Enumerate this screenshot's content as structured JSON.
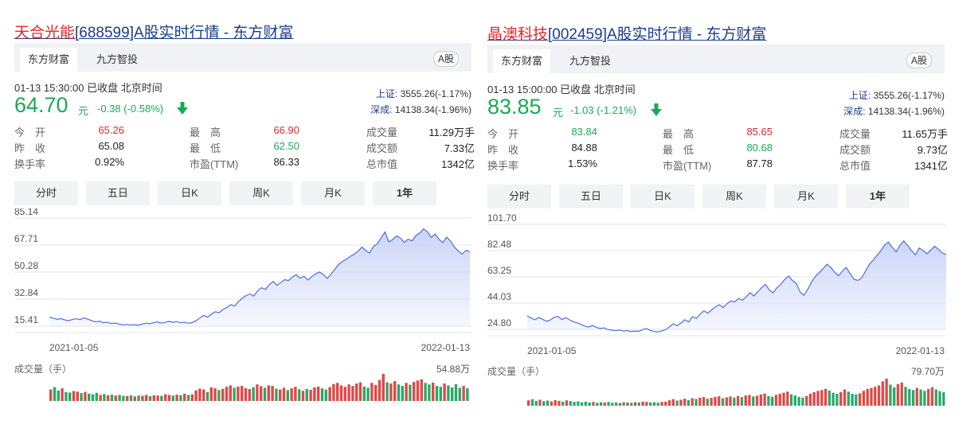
{
  "panels": [
    {
      "title_name": "天合光能",
      "title_rest": "[688599]A股实时行情 - 东方财富",
      "sources": [
        "东方财富",
        "九方智投"
      ],
      "badge": "A股",
      "time_status": "01-13 15:30:00  已收盘  北京时间",
      "price": "64.70",
      "unit": "元",
      "change": "-0.38 (-0.58%)",
      "indices": [
        {
          "label": "上证:",
          "value": "3555.26(-1.17%)"
        },
        {
          "label": "深成:",
          "value": "14138.34(-1.96%)"
        }
      ],
      "stats": [
        [
          {
            "label": "今　开",
            "value": "65.26",
            "tone": "red"
          },
          {
            "label": "最　高",
            "value": "66.90",
            "tone": "red"
          },
          {
            "label": "成交量",
            "value": "11.29万手",
            "tone": "dark"
          }
        ],
        [
          {
            "label": "昨　收",
            "value": "65.08",
            "tone": "dark"
          },
          {
            "label": "最　低",
            "value": "62.50",
            "tone": "green"
          },
          {
            "label": "成交额",
            "value": "7.33亿",
            "tone": "dark"
          }
        ],
        [
          {
            "label": "换手率",
            "value": "0.92%",
            "tone": "dark"
          },
          {
            "label": "市盈(TTM)",
            "value": "86.33",
            "tone": "dark"
          },
          {
            "label": "总市值",
            "value": "1342亿",
            "tone": "dark"
          }
        ]
      ],
      "tabs": [
        "分时",
        "五日",
        "日K",
        "周K",
        "月K",
        "1年"
      ],
      "active_tab": "1年",
      "volume_label": "成交量（手）",
      "volume_max": "54.88万",
      "chart_data": {
        "type": "area",
        "title": "",
        "x_start": "2021-01-05",
        "x_end": "2022-01-13",
        "ylim": [
          15.41,
          85.14
        ],
        "yticks": [
          "85.14",
          "67.71",
          "50.28",
          "32.84",
          "15.41"
        ],
        "grid": true,
        "line_color": "#4a6fe0",
        "fill_color": "#c8d2f6",
        "values": [
          21.2,
          20.6,
          19.8,
          20.3,
          19.4,
          18.9,
          19.8,
          20.2,
          19.6,
          20.8,
          19.9,
          18.9,
          18.2,
          18.6,
          17.6,
          17.9,
          17.1,
          17.4,
          16.8,
          16.2,
          16.6,
          16.1,
          16.4,
          16.0,
          16.7,
          17.3,
          17.0,
          17.6,
          18.1,
          17.4,
          17.8,
          18.5,
          17.9,
          18.4,
          17.6,
          17.9,
          17.3,
          17.7,
          18.9,
          20.7,
          22.4,
          21.2,
          23.2,
          24.7,
          24.1,
          26.2,
          27.4,
          29.2,
          28.4,
          31.2,
          33.4,
          35.1,
          36.2,
          34.8,
          38.3,
          40.2,
          39.1,
          42.1,
          44.3,
          41.7,
          43.5,
          45.4,
          44.8,
          47.2,
          48.6,
          46.3,
          47.6,
          45.2,
          47.3,
          49.1,
          50.4,
          48.7,
          46.2,
          48.8,
          52.1,
          55.3,
          57.2,
          58.6,
          60.4,
          61.8,
          63.7,
          66.4,
          64.1,
          62.6,
          66.9,
          68.4,
          72.4,
          76.1,
          69.7,
          71.3,
          73.6,
          72.1,
          69.4,
          71.5,
          70.3,
          73.8,
          75.4,
          78.1,
          76.2,
          72.6,
          74.8,
          71.4,
          69.3,
          72.8,
          70.2,
          66.4,
          63.8,
          61.8,
          64.3,
          63.3
        ]
      },
      "volume": [
        0.38,
        0.46,
        0.35,
        0.42,
        0.3,
        0.28,
        0.33,
        0.31,
        0.26,
        0.3,
        0.24,
        0.22,
        0.27,
        0.2,
        0.23,
        0.19,
        0.21,
        0.18,
        0.2,
        0.17,
        0.16,
        0.19,
        0.15,
        0.18,
        0.17,
        0.2,
        0.16,
        0.19,
        0.18,
        0.17,
        0.22,
        0.2,
        0.18,
        0.21,
        0.19,
        0.24,
        0.2,
        0.22,
        0.35,
        0.41,
        0.38,
        0.3,
        0.45,
        0.42,
        0.36,
        0.4,
        0.47,
        0.52,
        0.44,
        0.48,
        0.5,
        0.43,
        0.4,
        0.46,
        0.55,
        0.49,
        0.44,
        0.52,
        0.5,
        0.41,
        0.38,
        0.44,
        0.36,
        0.42,
        0.47,
        0.39,
        0.34,
        0.4,
        0.37,
        0.45,
        0.48,
        0.42,
        0.38,
        0.46,
        0.56,
        0.6,
        0.52,
        0.47,
        0.55,
        0.5,
        0.58,
        0.62,
        0.48,
        0.44,
        0.6,
        0.53,
        0.7,
        0.9,
        0.62,
        0.58,
        0.66,
        0.55,
        0.5,
        0.6,
        0.54,
        0.63,
        0.68,
        0.72,
        0.6,
        0.55,
        0.61,
        0.5,
        0.47,
        0.58,
        0.52,
        0.45,
        0.56,
        0.44,
        0.5,
        0.42
      ],
      "volume_colors": {
        "up": "#e04848",
        "down": "#29a86a"
      }
    },
    {
      "title_name": "晶澳科技",
      "title_rest": "[002459]A股实时行情 - 东方财富",
      "sources": [
        "东方财富",
        "九方智投"
      ],
      "badge": "A股",
      "time_status": "01-13 15:00:00  已收盘  北京时间",
      "price": "83.85",
      "unit": "元",
      "change": "-1.03 (-1.21%)",
      "indices": [
        {
          "label": "上证:",
          "value": "3555.26(-1.17%)"
        },
        {
          "label": "深成:",
          "value": "14138.34(-1.96%)"
        }
      ],
      "stats": [
        [
          {
            "label": "今　开",
            "value": "83.84",
            "tone": "green"
          },
          {
            "label": "最　高",
            "value": "85.65",
            "tone": "red"
          },
          {
            "label": "成交量",
            "value": "11.65万手",
            "tone": "dark"
          }
        ],
        [
          {
            "label": "昨　收",
            "value": "84.88",
            "tone": "dark"
          },
          {
            "label": "最　低",
            "value": "80.68",
            "tone": "green"
          },
          {
            "label": "成交额",
            "value": "9.73亿",
            "tone": "dark"
          }
        ],
        [
          {
            "label": "换手率",
            "value": "1.53%",
            "tone": "dark"
          },
          {
            "label": "市盈(TTM)",
            "value": "87.78",
            "tone": "dark"
          },
          {
            "label": "总市值",
            "value": "1341亿",
            "tone": "dark"
          }
        ]
      ],
      "tabs": [
        "分时",
        "五日",
        "日K",
        "周K",
        "月K",
        "1年"
      ],
      "active_tab": "1年",
      "volume_label": "成交量（手）",
      "volume_max": "79.70万",
      "chart_data": {
        "type": "area",
        "title": "",
        "x_start": "2021-01-05",
        "x_end": "2022-01-13",
        "ylim": [
          24.8,
          101.7
        ],
        "yticks": [
          "101.70",
          "82.48",
          "63.25",
          "44.03",
          "24.80"
        ],
        "grid": true,
        "line_color": "#4a6fe0",
        "fill_color": "#c8d2f6",
        "values": [
          34.6,
          33.1,
          31.8,
          33.4,
          32.2,
          30.6,
          31.7,
          33.6,
          34.2,
          32.1,
          33.3,
          31.8,
          30.4,
          29.6,
          28.4,
          27.1,
          26.5,
          27.6,
          26.3,
          25.4,
          25.9,
          24.6,
          24.2,
          23.8,
          24.3,
          23.5,
          23.9,
          23.1,
          23.6,
          23.3,
          24.6,
          25.4,
          24.1,
          23.2,
          22.9,
          23.6,
          24.5,
          26.6,
          28.9,
          27.4,
          29.4,
          31.8,
          30.2,
          34.1,
          32.7,
          35.9,
          38.4,
          36.6,
          39.1,
          41.4,
          42.8,
          40.7,
          43.6,
          45.6,
          44.9,
          47.4,
          46.1,
          48.8,
          51.6,
          49.2,
          52.4,
          55.3,
          57.8,
          53.6,
          51.6,
          55.4,
          57.7,
          61.4,
          63.8,
          60.6,
          58.4,
          52.2,
          49.7,
          54.1,
          59.6,
          63.6,
          66.4,
          69.3,
          72.5,
          70.1,
          66.6,
          64.1,
          67.4,
          70.2,
          65.6,
          61.5,
          60.6,
          62.3,
          67.4,
          72.4,
          75.4,
          78.9,
          82.4,
          86.6,
          88.7,
          84.8,
          81.6,
          86.5,
          89.6,
          86.1,
          82.5,
          79.3,
          84.4,
          82.6,
          80.1,
          82.8,
          85.6,
          83.4,
          80.7,
          79.6
        ]
      },
      "volume": [
        0.2,
        0.24,
        0.18,
        0.22,
        0.17,
        0.19,
        0.16,
        0.21,
        0.18,
        0.15,
        0.2,
        0.17,
        0.14,
        0.16,
        0.13,
        0.15,
        0.12,
        0.14,
        0.11,
        0.13,
        0.12,
        0.14,
        0.11,
        0.12,
        0.1,
        0.13,
        0.12,
        0.11,
        0.13,
        0.12,
        0.15,
        0.14,
        0.12,
        0.13,
        0.11,
        0.14,
        0.15,
        0.2,
        0.24,
        0.19,
        0.22,
        0.26,
        0.21,
        0.28,
        0.25,
        0.3,
        0.32,
        0.26,
        0.29,
        0.33,
        0.35,
        0.28,
        0.31,
        0.34,
        0.3,
        0.36,
        0.32,
        0.38,
        0.4,
        0.34,
        0.37,
        0.42,
        0.45,
        0.36,
        0.33,
        0.4,
        0.44,
        0.48,
        0.52,
        0.42,
        0.38,
        0.32,
        0.3,
        0.36,
        0.44,
        0.5,
        0.55,
        0.58,
        0.62,
        0.56,
        0.48,
        0.44,
        0.5,
        0.6,
        0.52,
        0.44,
        0.42,
        0.46,
        0.55,
        0.62,
        0.66,
        0.7,
        0.75,
        0.9,
        1.0,
        0.78,
        0.68,
        0.8,
        0.86,
        0.7,
        0.62,
        0.58,
        0.66,
        0.6,
        0.55,
        0.62,
        0.68,
        0.6,
        0.54,
        0.5
      ],
      "volume_colors": {
        "up": "#e04848",
        "down": "#29a86a"
      }
    }
  ]
}
